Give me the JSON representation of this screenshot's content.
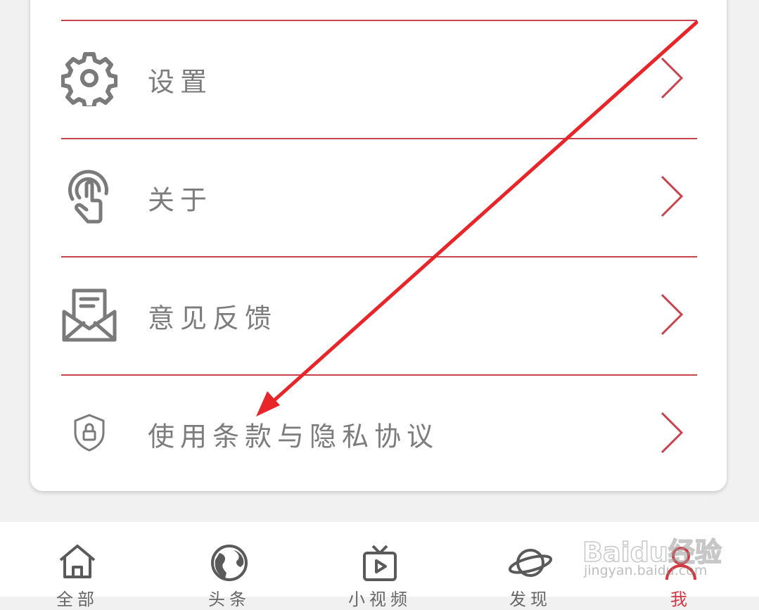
{
  "menu": {
    "items": [
      {
        "label": "设置",
        "icon": "gear-icon"
      },
      {
        "label": "关于",
        "icon": "touch-hand-icon"
      },
      {
        "label": "意见反馈",
        "icon": "mail-feedback-icon"
      },
      {
        "label": "使用条款与隐私协议",
        "icon": "shield-lock-icon"
      }
    ],
    "chevron_icon": "chevron-right-icon"
  },
  "tabbar": {
    "tabs": [
      {
        "label": "全部",
        "icon": "home-icon",
        "active": false
      },
      {
        "label": "头条",
        "icon": "globe-icon",
        "active": false
      },
      {
        "label": "小视频",
        "icon": "tv-icon",
        "active": false
      },
      {
        "label": "发现",
        "icon": "planet-icon",
        "active": false
      },
      {
        "label": "我",
        "icon": "profile-icon",
        "active": true
      }
    ]
  },
  "watermark": {
    "main": "Baidu经验",
    "sub": "jingyan.baidu.com"
  },
  "colors": {
    "accent": "#c9434d",
    "annotation_arrow": "#e8262a",
    "icon_gray": "#7a7a7a",
    "label_gray": "#7c7c7c",
    "background": "#f1f1f1"
  }
}
